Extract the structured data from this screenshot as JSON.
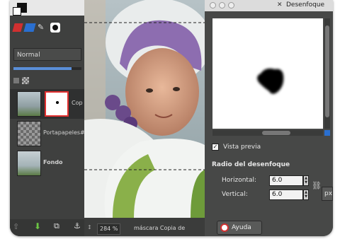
{
  "layers_panel": {
    "mode_value": "Normal",
    "opacity_fraction": 0.85,
    "layers": [
      {
        "label": "Cop",
        "selected": true
      },
      {
        "label": "Portapapeles#",
        "selected": false
      },
      {
        "label": "Fondo",
        "selected": false
      }
    ]
  },
  "statusbar": {
    "zoom": "284 %",
    "layer_text": "máscara Copia de"
  },
  "dialog": {
    "title": "Desenfoque",
    "preview_label": "Vista previa",
    "preview_checked": true,
    "section_title": "Radio del desenfoque",
    "horizontal_label": "Horizontal:",
    "horizontal_value": "6.0",
    "vertical_label": "Vertical:",
    "vertical_value": "6.0",
    "unit": "px",
    "help_label": "Ayuda"
  },
  "colors": {
    "dock_bg": "#3f403f",
    "dialog_bg": "#474847",
    "selection_red": "#e23030",
    "accent_blue": "#5a8fd8"
  }
}
